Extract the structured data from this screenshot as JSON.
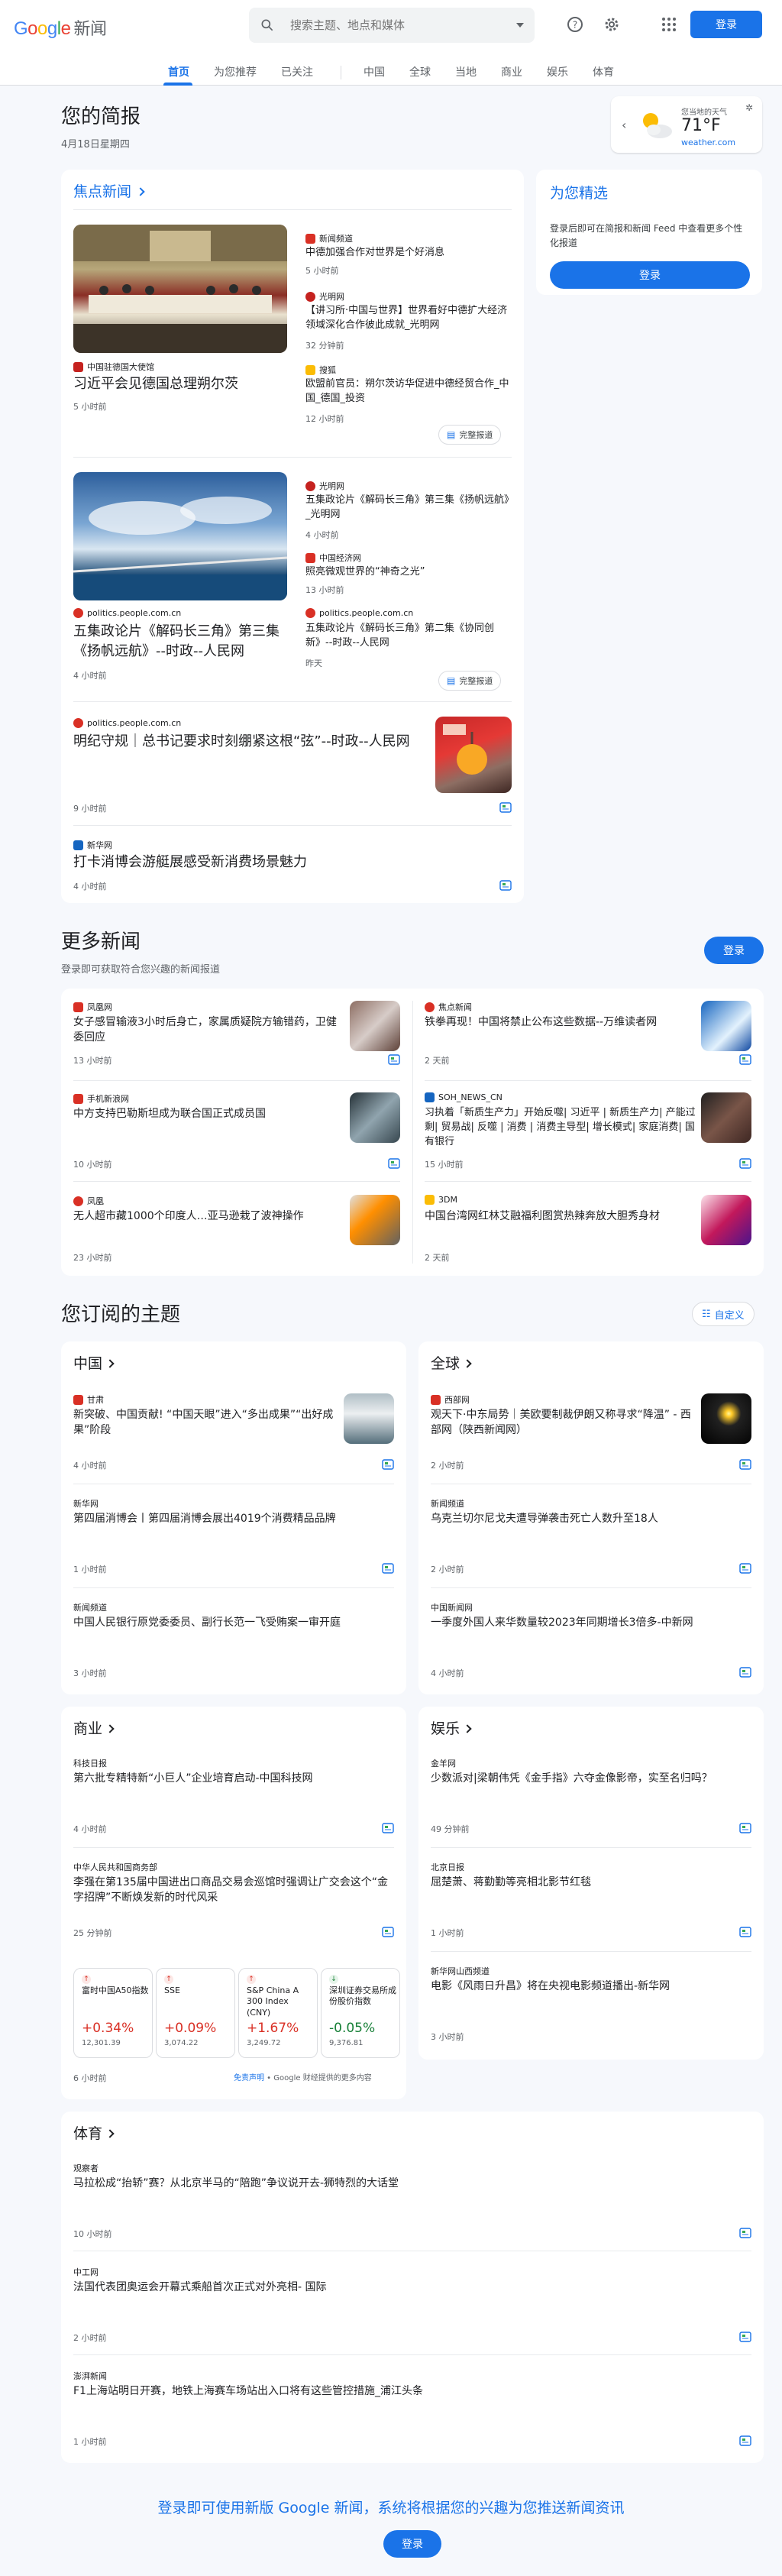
{
  "header": {
    "logo_word": [
      "G",
      "o",
      "o",
      "g",
      "l",
      "e"
    ],
    "news_word": "新闻",
    "search_placeholder": "搜索主题、地点和媒体",
    "signin": "登录",
    "icons": [
      "help-icon",
      "settings-icon",
      "apps-icon"
    ]
  },
  "nav": {
    "tabs": [
      "首页",
      "为您推荐",
      "已关注",
      "中国",
      "全球",
      "当地",
      "商业",
      "娱乐",
      "体育"
    ],
    "active": "首页"
  },
  "briefing": {
    "title": "您的简报",
    "date": "4月18日星期四"
  },
  "weather": {
    "location": "您当地的天气",
    "temp": "71°F",
    "source": "weather.com",
    "icon": "partly-cloudy-icon"
  },
  "top_stories": {
    "title": "焦点新闻",
    "full_coverage": "完整报道",
    "cluster1": {
      "source": "中国驻德国大使馆",
      "headline": "习近平会见德国总理朔尔茨",
      "time": "5 小时前",
      "related": [
        {
          "source": "新闻频道",
          "headline": "中德加强合作对世界是个好消息",
          "time": "5 小时前"
        },
        {
          "source": "光明网",
          "headline": "【讲习所·中国与世界】世界看好中德扩大经济领域深化合作彼此成就_光明网",
          "time": "32 分钟前"
        },
        {
          "source": "搜狐",
          "headline": "欧盟前官员：朔尔茨访华促进中德经贸合作_中国_德国_投资",
          "time": "12 小时前"
        }
      ]
    },
    "cluster2": {
      "source": "politics.people.com.cn",
      "headline": "五集政论片《解码长三角》第三集《扬帆远航》--时政--人民网",
      "time": "4 小时前",
      "related": [
        {
          "source": "光明网",
          "headline": "五集政论片《解码长三角》第三集《扬帆远航》_光明网",
          "time": "4 小时前"
        },
        {
          "source": "中国经济网",
          "headline": "照亮微观世界的“神奇之光”",
          "time": "13 小时前"
        },
        {
          "source": "politics.people.com.cn",
          "headline": "五集政论片《解码长三角》第二集《协同创新》--时政--人民网",
          "time": "昨天"
        }
      ]
    },
    "story3": {
      "source": "politics.people.com.cn",
      "headline": "明纪守规｜总书记要求时刻绷紧这根“弦”--时政--人民网",
      "time": "9 小时前"
    },
    "story4": {
      "source": "新华网",
      "headline": "打卡消博会游艇展感受新消费场景魅力",
      "time": "4 小时前"
    }
  },
  "for_you": {
    "title": "为您精选",
    "text": "登录后即可在简报和新闻 Feed 中查看更多个性化报道",
    "button": "登录"
  },
  "more_news": {
    "title": "更多新闻",
    "subtitle": "登录即可获取符合您兴趣的新闻报道",
    "button": "登录",
    "items": [
      {
        "source": "凤凰网",
        "headline": "女子感冒输液3小时后身亡，家属质疑院方输错药，卫健委回应",
        "time": "13 小时前"
      },
      {
        "source": "焦点新闻",
        "headline": "铁拳再现！中国将禁止公布这些数据--万维读者网",
        "time": "2 天前"
      },
      {
        "source": "手机新浪网",
        "headline": "中方支持巴勒斯坦成为联合国正式成员国",
        "time": "10 小时前"
      },
      {
        "source": "SOH_NEWS_CN",
        "headline": "习执着「新质生产力」开始反噬| 习近平 | 新质生产力| 产能过剩| 贸易战| 反噬 | 消费 | 消费主导型| 增长模式| 家庭消费| 国有银行",
        "time": "15 小时前"
      },
      {
        "source": "凤凰",
        "headline": "无人超市藏1000个印度人…亚马逊栽了波神操作",
        "time": "23 小时前"
      },
      {
        "source": "3DM",
        "headline": "中国台湾网红林艾融福利图赏热辣奔放大胆秀身材",
        "time": "2 天前"
      }
    ]
  },
  "subscribed": {
    "title": "您订阅的主题",
    "customize": "自定义",
    "china": {
      "title": "中国",
      "items": [
        {
          "source": "甘肃",
          "headline": "新突破、中国贡献! “中国天眼”进入“多出成果”“出好成果”阶段",
          "time": "4 小时前"
        },
        {
          "source": "新华网",
          "headline": "第四届消博会丨第四届消博会展出4019个消费精品品牌",
          "time": "1 小时前"
        },
        {
          "source": "新闻频道",
          "headline": "中国人民银行原党委委员、副行长范一飞受贿案一审开庭",
          "time": "3 小时前"
        }
      ]
    },
    "world": {
      "title": "全球",
      "items": [
        {
          "source": "西部网",
          "headline": "观天下·中东局势｜美欧要制裁伊朗又称寻求“降温” - 西部网（陕西新闻网）",
          "time": "2 小时前"
        },
        {
          "source": "新闻频道",
          "headline": "乌克兰切尔尼戈夫遭导弹袭击死亡人数升至18人",
          "time": "2 小时前"
        },
        {
          "source": "中国新闻网",
          "headline": "一季度外国人来华数量较2023年同期增长3倍多-中新网",
          "time": "4 小时前"
        }
      ]
    },
    "business": {
      "title": "商业",
      "items": [
        {
          "source": "科技日报",
          "headline": "第六批专精特新“小巨人”企业培育启动-中国科技网",
          "time": "4 小时前"
        },
        {
          "source": "中华人民共和国商务部",
          "headline": "李强在第135届中国进出口商品交易会巡馆时强调让广交会这个“金字招牌”不断焕发新的时代风采",
          "time": "25 分钟前"
        }
      ],
      "markets": [
        {
          "name": "富时中国A50指数",
          "change": "+0.34%",
          "value": "12,301.39",
          "dir": "up"
        },
        {
          "name": "SSE",
          "change": "+0.09%",
          "value": "3,074.22",
          "dir": "up"
        },
        {
          "name": "S&P China A 300 Index (CNY)",
          "change": "+1.67%",
          "value": "3,249.72",
          "dir": "up"
        },
        {
          "name": "深圳证券交易所成份股价指数",
          "change": "-0.05%",
          "value": "9,376.81",
          "dir": "down"
        }
      ],
      "market_time": "6 小时前",
      "disclaimer_a": "免责声明",
      "disclaimer_b": " • Google 财经提供的更多内容"
    },
    "entertainment": {
      "title": "娱乐",
      "items": [
        {
          "source": "金羊网",
          "headline": "少数派对|梁朝伟凭《金手指》六夺金像影帝，实至名归吗？",
          "time": "49 分钟前"
        },
        {
          "source": "北京日报",
          "headline": "屈楚萧、蒋勤勤等亮相北影节红毯",
          "time": "1 小时前"
        },
        {
          "source": "新华网山西频道",
          "headline": "电影《风雨日升昌》将在央视电影频道播出-新华网",
          "time": "3 小时前"
        }
      ]
    },
    "sports": {
      "title": "体育",
      "items": [
        {
          "source": "观察者",
          "headline": "马拉松成“抬轿”赛？从北京半马的“陪跑”争议说开去-狮特烈的大话堂",
          "time": "10 小时前"
        },
        {
          "source": "中工网",
          "headline": "法国代表团奥运会开幕式乘船首次正式对外亮相- 国际",
          "time": "2 小时前"
        },
        {
          "source": "澎湃新闻",
          "headline": "F1上海站明日开赛，地铁上海赛车场站出入口将有这些管控措施_浦江头条",
          "time": "1 小时前"
        }
      ]
    }
  },
  "footer": {
    "cta": "登录即可使用新版 Google 新闻，系统将根据您的兴趣为您推送新闻资讯",
    "button": "登录"
  },
  "colors": {
    "accent": "#1a73e8",
    "up": "#d93025",
    "down": "#188038"
  }
}
